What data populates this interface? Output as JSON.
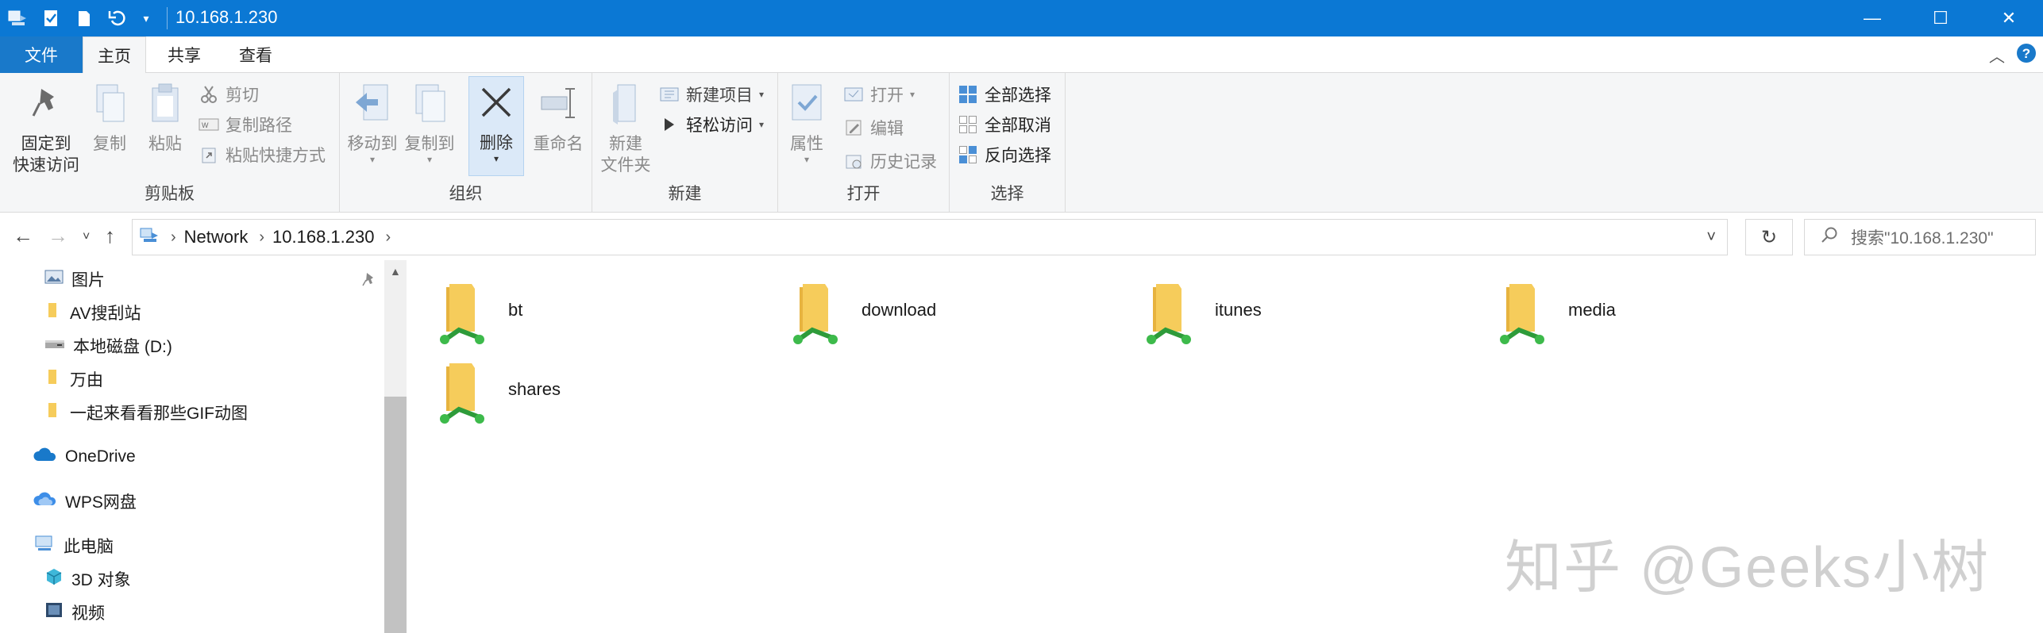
{
  "window": {
    "title": "10.168.1.230"
  },
  "ribbon_tabs": [
    {
      "label": "文件"
    },
    {
      "label": "主页"
    },
    {
      "label": "共享"
    },
    {
      "label": "查看"
    }
  ],
  "clipboard": {
    "title": "剪贴板",
    "pin_line1": "固定到",
    "pin_line2": "快速访问",
    "copy": "复制",
    "paste": "粘贴",
    "cut": "剪切",
    "copy_path": "复制路径",
    "paste_shortcut": "粘贴快捷方式"
  },
  "organize": {
    "title": "组织",
    "move_to": "移动到",
    "copy_to": "复制到",
    "delete": "删除",
    "rename": "重命名"
  },
  "new": {
    "title": "新建",
    "new_folder_line1": "新建",
    "new_folder_line2": "文件夹",
    "new_item": "新建项目",
    "easy_access": "轻松访问"
  },
  "open": {
    "title": "打开",
    "properties": "属性",
    "open": "打开",
    "edit": "编辑",
    "history": "历史记录"
  },
  "select": {
    "title": "选择",
    "select_all": "全部选择",
    "select_none": "全部取消",
    "invert": "反向选择"
  },
  "address": {
    "crumbs": [
      "Network",
      "10.168.1.230"
    ],
    "search_placeholder": "搜索\"10.168.1.230\""
  },
  "nav_items": [
    {
      "label": "图片",
      "icon": "pictures-icon"
    },
    {
      "label": "AV搜刮站",
      "icon": "folder-icon"
    },
    {
      "label": "本地磁盘 (D:)",
      "icon": "drive-icon"
    },
    {
      "label": "万由",
      "icon": "folder-icon"
    },
    {
      "label": "一起来看看那些GIF动图",
      "icon": "folder-icon"
    },
    {
      "label": "OneDrive",
      "icon": "onedrive-icon"
    },
    {
      "label": "WPS网盘",
      "icon": "cloud-icon"
    },
    {
      "label": "此电脑",
      "icon": "computer-icon"
    },
    {
      "label": "3D 对象",
      "icon": "3d-objects-icon"
    },
    {
      "label": "视频",
      "icon": "videos-icon"
    }
  ],
  "shares": [
    {
      "name": "bt"
    },
    {
      "name": "download"
    },
    {
      "name": "itunes"
    },
    {
      "name": "media"
    },
    {
      "name": "shares"
    }
  ],
  "watermark": "知乎 @Geeks小树",
  "colors": {
    "titlebar": "#0b78d4",
    "file_tab": "#1979ca",
    "ribbon_bg": "#f5f6f7"
  }
}
